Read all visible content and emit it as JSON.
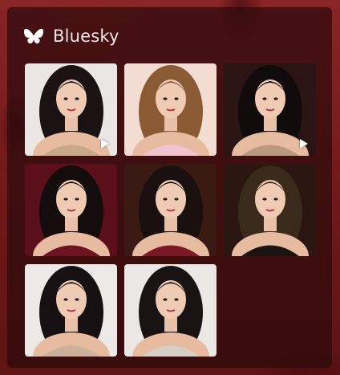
{
  "header": {
    "title": "Bluesky",
    "logo_icon": "butterfly-icon"
  },
  "gallery": {
    "items": [
      {
        "bg": "#e9e6e4",
        "accent": "#c9a98a",
        "hair": "#1a1213",
        "video": true
      },
      {
        "bg": "#f3ddd3",
        "accent": "#f0c4cf",
        "hair": "#8a5a34",
        "video": false
      },
      {
        "bg": "#2a1414",
        "accent": "#b99a80",
        "hair": "#120b0c",
        "video": true
      },
      {
        "bg": "#5a0f19",
        "accent": "#6e1420",
        "hair": "#140c0d",
        "video": false
      },
      {
        "bg": "#3a1a12",
        "accent": "#7a1826",
        "hair": "#1a1010",
        "video": false
      },
      {
        "bg": "#2b1612",
        "accent": "#1a1413",
        "hair": "#3a2a1c",
        "video": false
      },
      {
        "bg": "#ece9e7",
        "accent": "#cdb19a",
        "hair": "#181113",
        "video": false
      },
      {
        "bg": "#ebe7e4",
        "accent": "#d6cfc6",
        "hair": "#1a1314",
        "video": false
      }
    ]
  }
}
